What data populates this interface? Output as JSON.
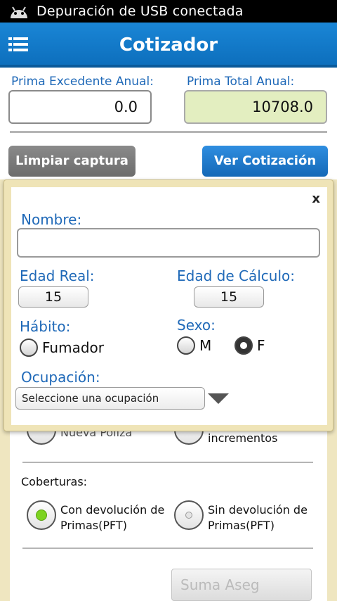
{
  "status_bar": {
    "text": "Depuración de USB conectada",
    "icon": "android-icon"
  },
  "app_bar": {
    "title": "Cotizador",
    "menu_icon": "menu-list-icon"
  },
  "header": {
    "prima_excedente_label": "Prima Excedente Anual:",
    "prima_excedente_value": "0.0",
    "prima_total_label": "Prima Total Anual:",
    "prima_total_value": "10708.0"
  },
  "buttons": {
    "clear": "Limpiar captura",
    "view_quote": "Ver Cotización"
  },
  "modal": {
    "close": "x",
    "nombre_label": "Nombre:",
    "nombre_value": "",
    "edad_real_label": "Edad Real:",
    "edad_real_value": "15",
    "edad_calculo_label": "Edad de Cálculo:",
    "edad_calculo_value": "15",
    "habito_label": "Hábito:",
    "fumador_label": "Fumador",
    "sexo_label": "Sexo:",
    "sexo_m": "M",
    "sexo_f": "F",
    "sexo_selected": "F",
    "ocupacion_label": "Ocupación:",
    "ocupacion_placeholder": "Seleccione una ocupación"
  },
  "background": {
    "nueva_poliza_partial": "Nueva Póliza",
    "incrementos_partial": "incrementos",
    "coberturas_label": "Coberturas:",
    "con_devolucion": "Con devolución de Primas(PFT)",
    "sin_devolucion": "Sin devolución de Primas(PFT)",
    "suma_asegurada_partial": "Suma Aseg"
  },
  "colors": {
    "accent": "#1f69b8",
    "appbar": "#1478c9",
    "selected_radio": "#7dd321"
  }
}
